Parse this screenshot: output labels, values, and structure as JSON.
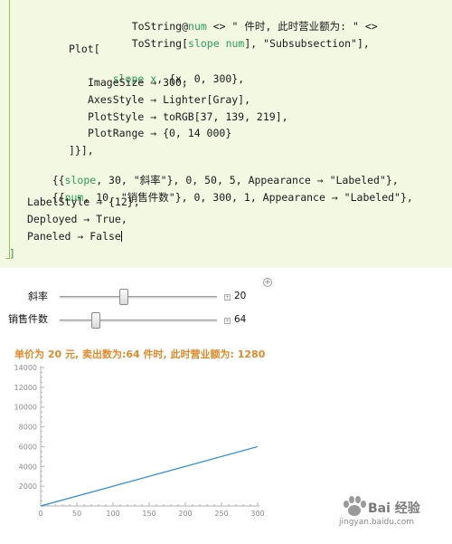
{
  "code": {
    "line1": {
      "text1": "ToString@",
      "var": "num",
      "text2": " <> \" 件时, 此时营业额为: \" <>"
    },
    "line2": {
      "text1": "ToString[",
      "var": "slope",
      "var2": "num",
      "text2": "], \"Subsubsection\"],"
    },
    "line3": "Plot[",
    "line4": {
      "var": "slope",
      "var2": "x",
      "text2": ", {x, 0, 300},"
    },
    "line5": "ImageSize → 300,",
    "line6": "AxesStyle → Lighter[Gray],",
    "line7": "PlotStyle → toRGB[37, 139, 219],",
    "line8": "PlotRange → {0, 14 000}",
    "line9": "]}],",
    "line10": {
      "text1": "{{",
      "var": "slope",
      "text2": ", 30, \"斜率\"}, 0, 50, 5, Appearance → \"Labeled\"},"
    },
    "line11": {
      "text1": "{{",
      "var": "num",
      "text2": ", 10, \"销售件数\"}, 0, 300, 1, Appearance → \"Labeled\"},"
    },
    "line12": "LabelStyle → {12},",
    "line13": "Deployed → True,",
    "line14": "Paneled → False",
    "line15": "]"
  },
  "controls": {
    "slope": {
      "label": "斜率",
      "value": "20",
      "min": 0,
      "max": 50,
      "current": 20
    },
    "num": {
      "label": "销售件数",
      "value": "64",
      "min": 0,
      "max": 300,
      "current": 64
    }
  },
  "plot_title": "单价为 20 元, 卖出数为:64 件时, 此时营业额为: 1280",
  "chart_data": {
    "type": "line",
    "title": "单价为 20 元, 卖出数为:64 件时, 此时营业额为: 1280",
    "x": [
      0,
      300
    ],
    "series": [
      {
        "values": [
          0,
          6000
        ],
        "color": "#258bdb"
      }
    ],
    "xlim": [
      0,
      300
    ],
    "ylim": [
      0,
      14000
    ],
    "xticks": [
      0,
      50,
      100,
      150,
      200,
      250,
      300
    ],
    "yticks": [
      2000,
      4000,
      6000,
      8000,
      10000,
      12000,
      14000
    ],
    "xlabel": "",
    "ylabel": "",
    "axes_color": "#b0b0b0",
    "grid": false
  },
  "watermark": {
    "text": "Bai 经验",
    "url": "jingyan.baidu.com"
  }
}
